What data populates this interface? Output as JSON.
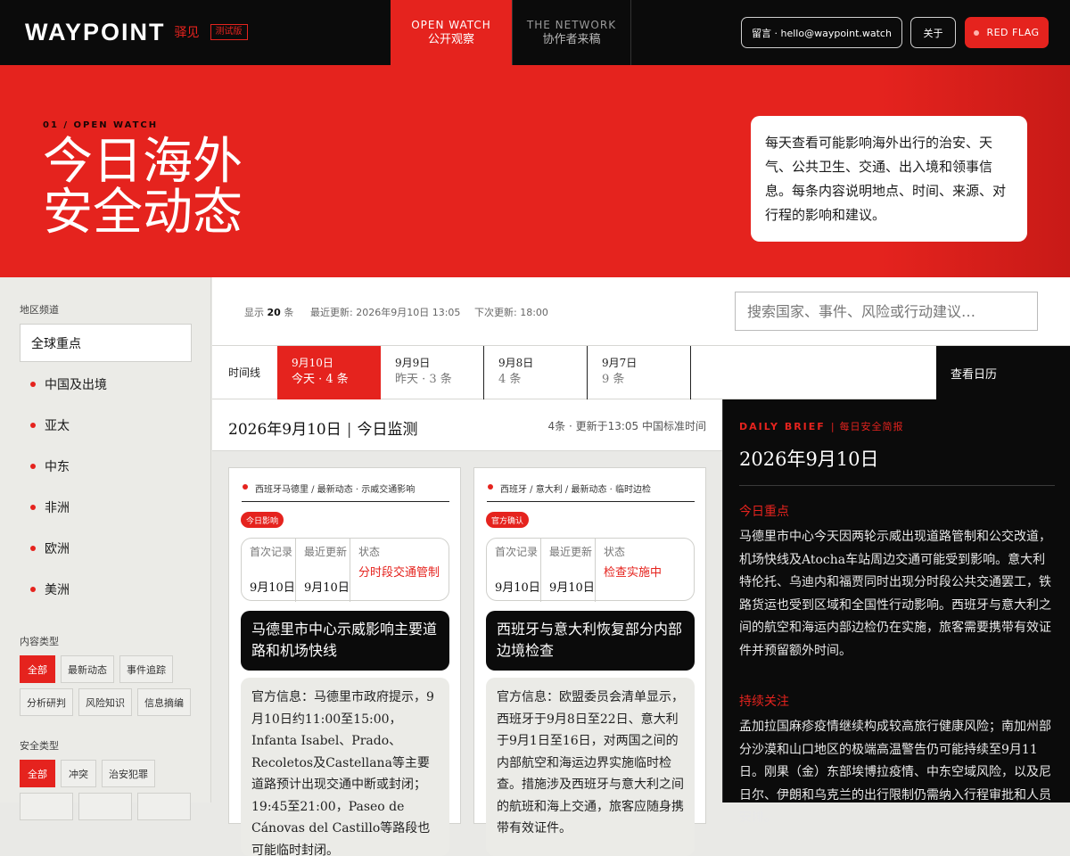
{
  "header": {
    "brand_en": "WAYPOINT",
    "brand_cn": "驿见",
    "beta": "测试版",
    "nav": [
      {
        "en": "OPEN WATCH",
        "cn": "公开观察"
      },
      {
        "en": "THE NETWORK",
        "cn": "协作者来稿"
      }
    ],
    "contact": "留言 · hello@waypoint.watch",
    "about": "关于",
    "red_flag": "RED FLAG"
  },
  "hero": {
    "kicker": "01 / OPEN WATCH",
    "title_line1": "今日海外",
    "title_line2": "安全动态",
    "description": "每天查看可能影响海外出行的治安、天气、公共卫生、交通、出入境和领事信息。每条内容说明地点、时间、来源、对行程的影响和建议。"
  },
  "sidebar": {
    "region_heading": "地区频道",
    "region_selected": "全球重点",
    "regions": [
      "中国及出境",
      "亚太",
      "中东",
      "非洲",
      "欧洲",
      "美洲"
    ],
    "content_heading": "内容类型",
    "content_types": [
      "全部",
      "最新动态",
      "事件追踪",
      "分析研判",
      "风险知识",
      "信息摘编"
    ],
    "security_heading": "安全类型",
    "security_types": [
      "全部",
      "冲突",
      "治安犯罪"
    ]
  },
  "toolbar": {
    "shown_label": "显示",
    "shown_count": "20",
    "shown_unit": "条",
    "updated_label": "最近更新:",
    "updated_value": "2026年9月10日 13:05",
    "next_label": "下次更新:",
    "next_value": "18:00",
    "search_placeholder": "搜索国家、事件、风险或行动建议…"
  },
  "timeline": {
    "label": "时间线",
    "items": [
      {
        "date": "9月10日",
        "count": "今天 · 4 条"
      },
      {
        "date": "9月9日",
        "count": "昨天 · 3 条"
      },
      {
        "date": "9月8日",
        "count": "4 条"
      },
      {
        "date": "9月7日",
        "count": "9 条"
      }
    ],
    "calendar": "查看日历"
  },
  "main": {
    "date": "2026年9月10日",
    "section": "今日监测",
    "meta": "4条 · 更新于13:05 中国标准时间"
  },
  "cards": [
    {
      "tag": "西班牙马德里 / 最新动态 · 示威交通影响",
      "pill": "今日影响",
      "first_label": "首次记录",
      "first_value": "9月10日",
      "latest_label": "最近更新",
      "latest_value": "9月10日",
      "status_label": "状态",
      "status_value": "分时段交通管制",
      "title": "马德里市中心示威影响主要道路和机场快线",
      "body": "官方信息：马德里市政府提示，9月10日约11:00至15:00，Infanta Isabel、Prado、Recoletos及Castellana等主要道路预计出现交通中断或封闭；19:45至21:00，Paseo de Cánovas del Castillo等路段也可能临时封闭。"
    },
    {
      "tag": "西班牙 / 意大利 / 最新动态 · 临时边检",
      "pill": "官方确认",
      "first_label": "首次记录",
      "first_value": "9月10日",
      "latest_label": "最近更新",
      "latest_value": "9月10日",
      "status_label": "状态",
      "status_value": "检查实施中",
      "title": "西班牙与意大利恢复部分内部边境检查",
      "body": "官方信息：欧盟委员会清单显示，西班牙于9月8日至22日、意大利于9月1日至16日，对两国之间的内部航空和海运边界实施临时检查。措施涉及西班牙与意大利之间的航班和海上交通，旅客应随身携带有效证件。"
    }
  ],
  "brief": {
    "kicker_en": "DAILY BRIEF",
    "kicker_cn": "每日安全简报",
    "date": "2026年9月10日",
    "focus_heading": "今日重点",
    "focus_text": "马德里市中心今天因两轮示威出现道路管制和公交改道，机场快线及Atocha车站周边交通可能受到影响。意大利特伦托、乌迪内和福贾同时出现分时段公共交通罢工，铁路货运也受到区域和全国性行动影响。西班牙与意大利之间的航空和海运内部边检仍在实施，旅客需要携带有效证件并预留额外时间。",
    "watch_heading": "持续关注",
    "watch_text": "孟加拉国麻疹疫情继续构成较高旅行健康风险；南加州部分沙漠和山口地区的极端高温警告仍可能持续至9月11日。刚果（金）东部埃博拉疫情、中东空域风险，以及尼日尔、伊朗和乌克兰的出行限制仍需纳入行程审批和人员安排。"
  }
}
